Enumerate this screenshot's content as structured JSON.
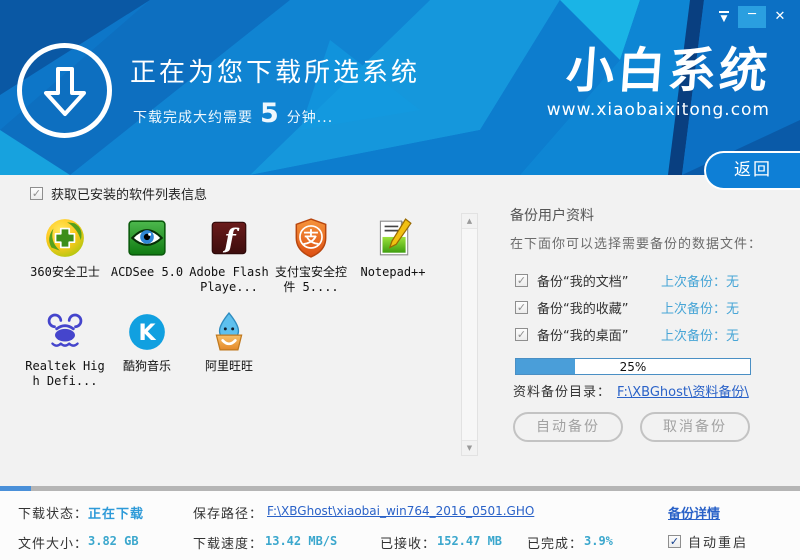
{
  "icons": {
    "skin_arrow": "▼",
    "minimize": "─",
    "close": "✕",
    "check": "✓",
    "scroll_up": "▲",
    "scroll_down": "▼",
    "flash_glyph": "f",
    "alipay_glyph": "支",
    "kugou_glyph": "K"
  },
  "header": {
    "title": "正在为您下载所选系统",
    "subtitle_prefix": "下载完成大约需要",
    "subtitle_minutes": "5",
    "subtitle_suffix": "分钟...",
    "logo_text": "小白系统",
    "logo_site": "www.xiaobaixitong.com",
    "back_button": "返回"
  },
  "software_panel": {
    "header_checkbox_label": "获取已安装的软件列表信息",
    "items": [
      {
        "name": "360安全卫士"
      },
      {
        "name": "ACDSee 5.0"
      },
      {
        "name": "Adobe Flash Playe..."
      },
      {
        "name": "支付宝安全控件 5...."
      },
      {
        "name": "Notepad++"
      },
      {
        "name": "Realtek High Defi..."
      },
      {
        "name": "酷狗音乐"
      },
      {
        "name": "阿里旺旺"
      }
    ]
  },
  "backup_panel": {
    "title": "备份用户资料",
    "subtitle": "在下面你可以选择需要备份的数据文件：",
    "items": [
      {
        "label": "备份“我的文档”",
        "status": "上次备份：无"
      },
      {
        "label": "备份“我的收藏”",
        "status": "上次备份：无"
      },
      {
        "label": "备份“我的桌面”",
        "status": "上次备份：无"
      }
    ],
    "progress_percent": "25%",
    "dir_label": "资料备份目录：",
    "dir_link": "F:\\XBGhost\\资料备份\\",
    "auto_backup_button": "自动备份",
    "cancel_backup_button": "取消备份"
  },
  "download": {
    "completed_fraction": 3.9
  },
  "status_bar": {
    "download_status_label": "下载状态：",
    "download_status_value": "正在下载",
    "save_path_label": "保存路径：",
    "save_path_link": "F:\\XBGhost\\xiaobai_win764_2016_0501.GHO",
    "backup_details_link": "备份详情",
    "file_size_label": "文件大小：",
    "file_size_value": "3.82 GB",
    "speed_label": "下载速度：",
    "speed_value": "13.42 MB/S",
    "received_label": "已接收：",
    "received_value": "152.47 MB",
    "completed_label": "已完成：",
    "completed_value": "3.9%",
    "auto_restart_label": "自动重启"
  }
}
